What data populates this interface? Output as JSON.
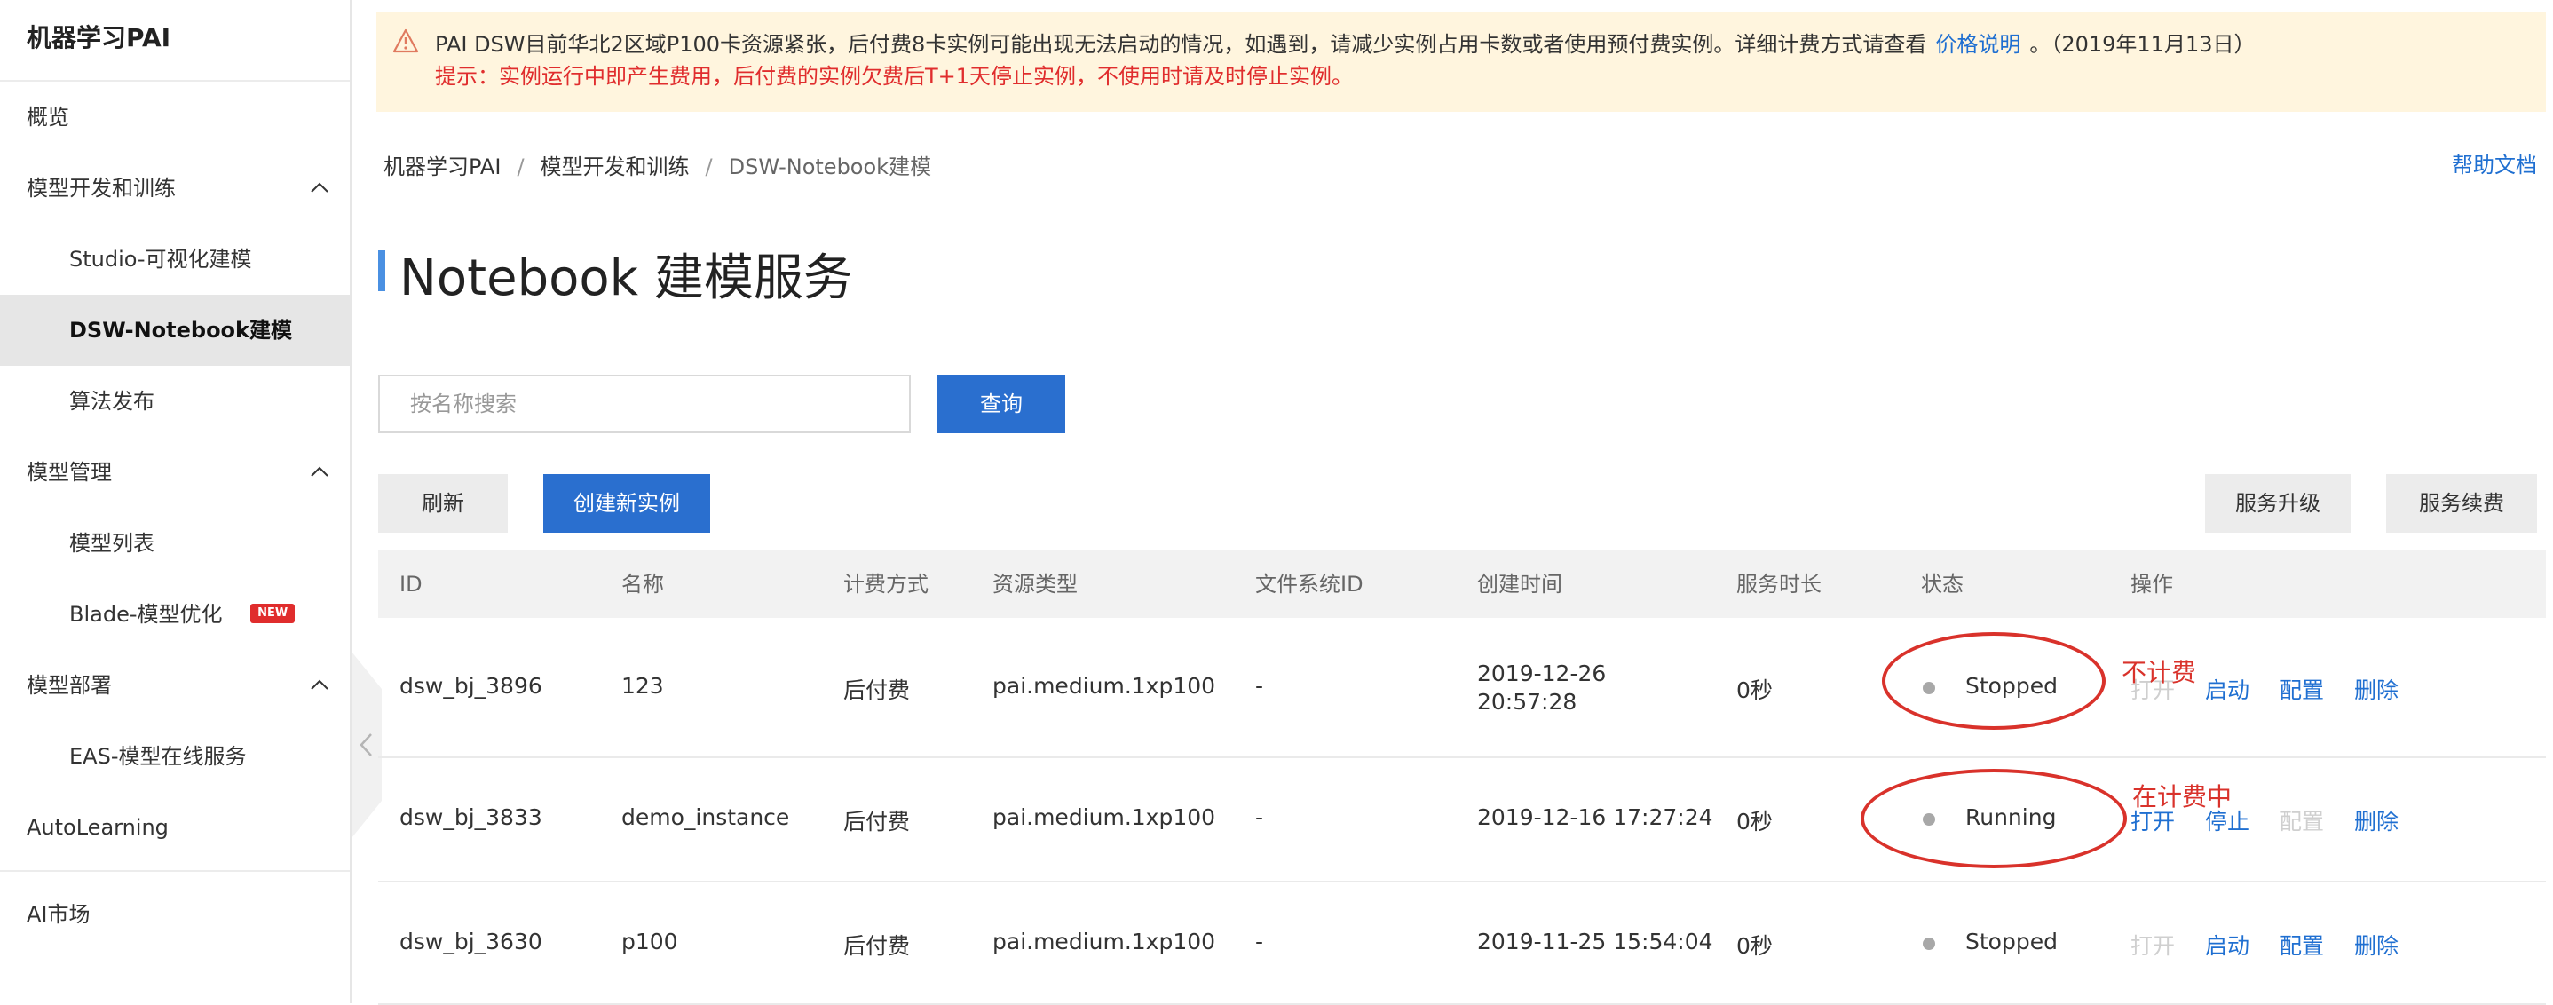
{
  "sidebar": {
    "brand": "机器学习PAI",
    "items": [
      {
        "label": "概览"
      },
      {
        "label": "模型开发和训练"
      },
      {
        "label": "Studio-可视化建模"
      },
      {
        "label": "DSW-Notebook建模"
      },
      {
        "label": "算法发布"
      },
      {
        "label": "模型管理"
      },
      {
        "label": "模型列表"
      },
      {
        "label": "Blade-模型优化",
        "badge": "NEW"
      },
      {
        "label": "模型部署"
      },
      {
        "label": "EAS-模型在线服务"
      },
      {
        "label": "AutoLearning"
      },
      {
        "label": "AI市场"
      }
    ]
  },
  "notice": {
    "line1_text": "PAI DSW目前华北2区域P100卡资源紧张，后付费8卡实例可能出现无法启动的情况，如遇到，请减少实例占用卡数或者使用预付费实例。详细计费方式请查看",
    "link": "价格说明",
    "line1_suffix": "。（2019年11月13日）",
    "line2_text": "提示：实例运行中即产生费用，后付费的实例欠费后T+1天停止实例，不使用时请及时停止实例。"
  },
  "breadcrumb": {
    "items": [
      "机器学习PAI",
      "模型开发和训练",
      "DSW-Notebook建模"
    ],
    "separator": "/"
  },
  "help_link": "帮助文档",
  "page_title": "Notebook 建模服务",
  "search": {
    "placeholder": "按名称搜索",
    "value": "",
    "button": "查询"
  },
  "toolbar": {
    "refresh": "刷新",
    "create": "创建新实例",
    "upgrade": "服务升级",
    "renew": "服务续费"
  },
  "table": {
    "headers": [
      "ID",
      "名称",
      "计费方式",
      "资源类型",
      "文件系统ID",
      "创建时间",
      "服务时长",
      "状态",
      "操作"
    ],
    "rows": [
      {
        "id": "dsw_bj_3896",
        "name": "123",
        "billing": "后付费",
        "resource": "pai.medium.1xp100",
        "fs_id": "-",
        "created_date": "2019-12-26",
        "created_time": "20:57:28",
        "duration": "0秒",
        "status": "Stopped",
        "ops": [
          {
            "label": "打开",
            "enabled": false
          },
          {
            "label": "启动",
            "enabled": true
          },
          {
            "label": "配置",
            "enabled": true
          },
          {
            "label": "删除",
            "enabled": true
          }
        ],
        "annotation": "不计费"
      },
      {
        "id": "dsw_bj_3833",
        "name": "demo_instance",
        "billing": "后付费",
        "resource": "pai.medium.1xp100",
        "fs_id": "-",
        "created_date": "2019-12-16 17:27:24",
        "created_time": "",
        "duration": "0秒",
        "status": "Running",
        "ops": [
          {
            "label": "打开",
            "enabled": true
          },
          {
            "label": "停止",
            "enabled": true
          },
          {
            "label": "配置",
            "enabled": false
          },
          {
            "label": "删除",
            "enabled": true
          }
        ],
        "annotation": "在计费中"
      },
      {
        "id": "dsw_bj_3630",
        "name": "p100",
        "billing": "后付费",
        "resource": "pai.medium.1xp100",
        "fs_id": "-",
        "created_date": "2019-11-25 15:54:04",
        "created_time": "",
        "duration": "0秒",
        "status": "Stopped",
        "ops": [
          {
            "label": "打开",
            "enabled": false
          },
          {
            "label": "启动",
            "enabled": true
          },
          {
            "label": "配置",
            "enabled": true
          },
          {
            "label": "删除",
            "enabled": true
          }
        ],
        "annotation": ""
      }
    ]
  },
  "colors": {
    "primary": "#2a6fcf",
    "link": "#1f6fd1",
    "warning_bg": "#fff5de",
    "danger": "#e02d2d",
    "annotation": "#d9322b"
  }
}
